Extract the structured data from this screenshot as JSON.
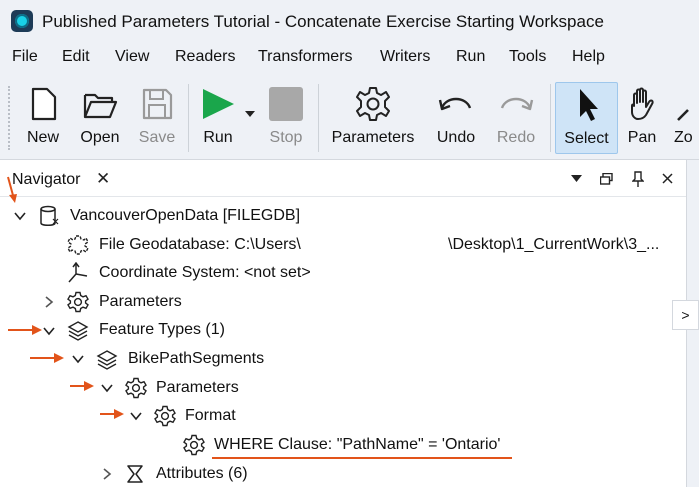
{
  "window": {
    "title": "Published Parameters Tutorial - Concatenate Exercise Starting Workspace"
  },
  "menu": {
    "items": [
      "File",
      "Edit",
      "View",
      "Readers",
      "Transformers",
      "Writers",
      "Run",
      "Tools",
      "Help"
    ]
  },
  "toolbar": {
    "new_label": "New",
    "open_label": "Open",
    "save_label": "Save",
    "run_label": "Run",
    "stop_label": "Stop",
    "parameters_label": "Parameters",
    "undo_label": "Undo",
    "redo_label": "Redo",
    "select_label": "Select",
    "pan_label": "Pan",
    "zoom_label": "Zo"
  },
  "navigator": {
    "title": "Navigator",
    "close_glyph": "✕",
    "rail_tab": ">",
    "tree": {
      "dataset": "VancouverOpenData [FILEGDB]",
      "file_gdb": "File Geodatabase: C:\\Users\\",
      "file_gdb_path_tail": "\\Desktop\\1_CurrentWork\\3_...",
      "coord_sys": "Coordinate System: <not set>",
      "parameters": "Parameters",
      "feature_types": "Feature Types (1)",
      "bike_path": "BikePathSegments",
      "ft_parameters": "Parameters",
      "format": "Format",
      "where_clause": "WHERE Clause: \"PathName\" = 'Ontario'",
      "attributes": "Attributes (6)"
    }
  },
  "colors": {
    "accent_orange": "#e2541a",
    "run_green": "#1aa64b",
    "select_bg": "#cfe4f7"
  }
}
